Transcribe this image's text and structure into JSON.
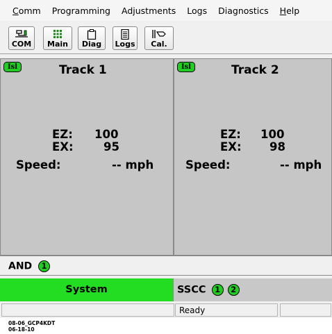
{
  "menu": [
    "Comm",
    "Programming",
    "Adjustments",
    "Logs",
    "Diagnostics",
    "Help"
  ],
  "toolbar": [
    {
      "label": "COM",
      "icon": "com-icon"
    },
    {
      "label": "Main",
      "icon": "grid-icon"
    },
    {
      "label": "Diag",
      "icon": "clipboard-icon"
    },
    {
      "label": "Logs",
      "icon": "log-document-icon"
    },
    {
      "label": "Cal.",
      "icon": "calibration-icon"
    }
  ],
  "tracks": [
    {
      "badge": "Isl",
      "title": "Track 1",
      "ez_label": "EZ:",
      "ez_value": "100",
      "ex_label": "EX:",
      "ex_value": "95",
      "speed_label": "Speed:",
      "speed_value": "-- mph"
    },
    {
      "badge": "Isl",
      "title": "Track 2",
      "ez_label": "EZ:",
      "ez_value": "100",
      "ex_label": "EX:",
      "ex_value": "98",
      "speed_label": "Speed:",
      "speed_value": "-- mph"
    }
  ],
  "and_bar": {
    "label": "AND",
    "indicator": "1"
  },
  "system": {
    "label": "System"
  },
  "sscc": {
    "label": "SSCC",
    "indicators": [
      "1",
      "2"
    ]
  },
  "status": {
    "text": "Ready"
  },
  "footer": {
    "line1": "08-06_GCP4KDT",
    "line2": "06-18-10"
  },
  "colors": {
    "active_green": "#22dd22",
    "panel_gray": "#c6c6c6"
  }
}
